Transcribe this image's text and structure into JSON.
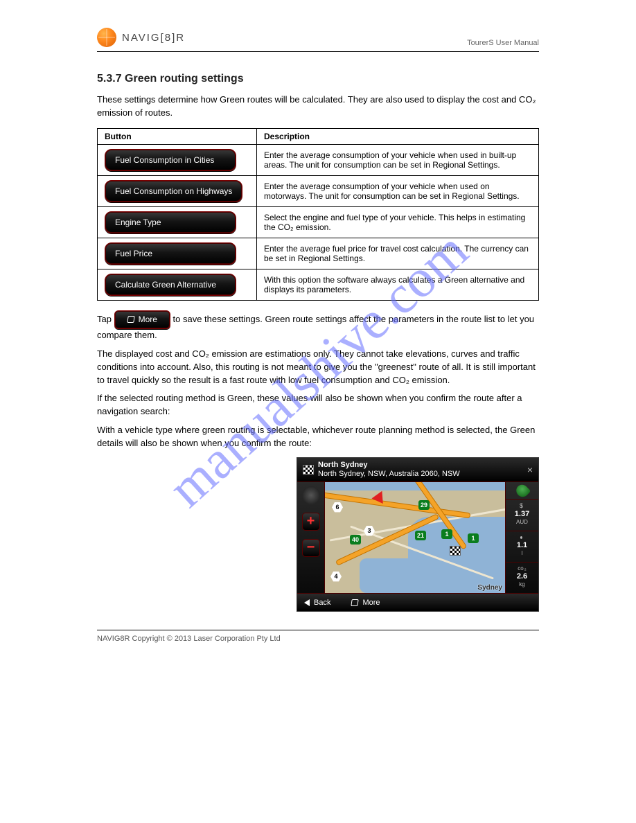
{
  "logo": {
    "text": "NAVIG[8]R"
  },
  "header_right": "TourerS User Manual",
  "section_title": "5.3.7 Green routing settings",
  "intro": "These settings determine how Green routes will be calculated. They are also used to display the cost and CO₂ emission of routes.",
  "table": {
    "h1": "Button",
    "h2": "Description",
    "rows": [
      {
        "btn": "Fuel Consumption in Cities",
        "desc": "Enter the average consumption of your vehicle when used in built-up areas. The unit for consumption can be set in Regional Settings."
      },
      {
        "btn": "Fuel Consumption on Highways",
        "desc": "Enter the average consumption of your vehicle when used on motorways. The unit for consumption can be set in Regional Settings."
      },
      {
        "btn": "Engine Type",
        "desc": "Select the engine and fuel type of your vehicle. This helps in estimating the CO₂ emission."
      },
      {
        "btn": "Fuel Price",
        "desc": "Enter the average fuel price for travel cost calculation. The currency can be set in Regional Settings."
      },
      {
        "btn": "Calculate Green Alternative",
        "desc": "With this option the software always calculates a Green alternative and displays its parameters."
      }
    ]
  },
  "more_label": "More",
  "body1": "Tap                                   to save these settings. Green route settings affect the parameters in the route list to let you compare them.",
  "para_cost": "The displayed cost and CO₂ emission are estimations only. They cannot take elevations, curves and traffic conditions into account. Also, this routing is not meant to give you the \"greenest\" route of all. It is still important to travel quickly so the result is a fast route with low fuel consumption and CO₂ emission.",
  "para_green1": "If the selected routing method is Green, these values will also be shown when you confirm the route after a navigation search:",
  "para_green2": "With a vehicle type where green routing is selectable, whichever route planning method is selected, the Green details will also be shown when you confirm the route:",
  "device": {
    "dest_title": "North Sydney",
    "dest_sub": "North Sydney, NSW, Australia 2060, NSW",
    "back": "Back",
    "more": "More",
    "stats": {
      "price": "1.37",
      "price_unit": "AUD",
      "fuel": "1.1",
      "fuel_unit": "l",
      "co2": "2.6",
      "co2_unit": "kg"
    },
    "shields": {
      "s6": "6",
      "s3": "3",
      "s40": "40",
      "s29": "29",
      "s21": "21",
      "s1": "1",
      "s1b": "1",
      "s4": "4"
    },
    "city": "Sydney"
  },
  "footer": "NAVIG8R Copyright © 2013 Laser Corporation Pty Ltd",
  "watermark": "manualshive.com"
}
